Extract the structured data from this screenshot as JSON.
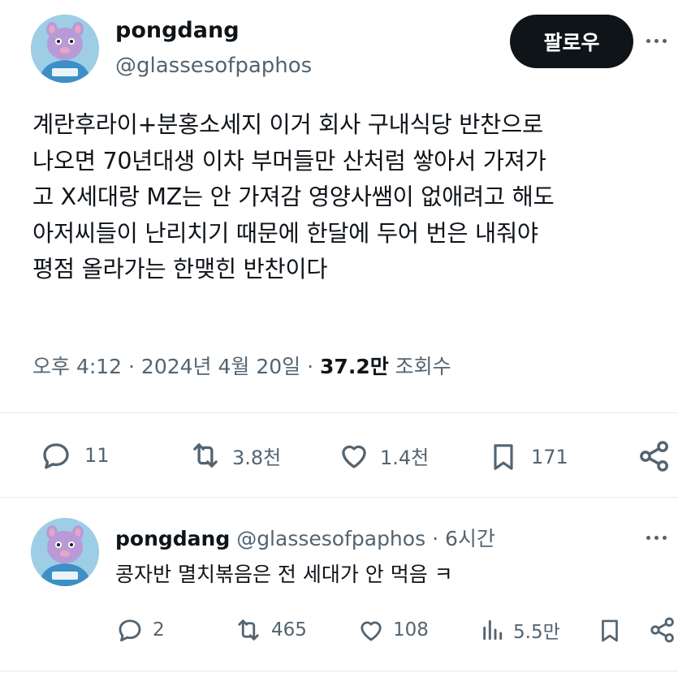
{
  "tweet": {
    "author": {
      "display_name": "pongdang",
      "handle": "@glassesofpaphos",
      "avatar_icon": "cartoon-avatar-icon"
    },
    "follow_label": "팔로우",
    "more_icon": "more-dots-icon",
    "text_lines": [
      "계란후라이+분홍소세지 이거 회사 구내식당 반찬으로",
      "나오면 70년대생 이차 부머들만 산처럼 쌓아서 가져가",
      "고 X세대랑 MZ는 안 가져감 영양사쌤이 없애려고 해도",
      "아저씨들이 난리치기 때문에 한달에 두어 번은 내줘야",
      "평점 올라가는 한맺힌 반찬이다"
    ],
    "timestamp": "오후 4:12 · 2024년 4월 20일",
    "views_count": "37.2만",
    "views_label": "조회수",
    "actions": {
      "replies": "11",
      "retweets": "3.8천",
      "likes": "1.4천",
      "bookmarks": "171"
    }
  },
  "reply": {
    "author": {
      "display_name": "pongdang",
      "handle": "@glassesofpaphos",
      "time": "6시간"
    },
    "text": "콩자반 멸치볶음은 전 세대가 안 먹음 ㅋ",
    "actions": {
      "replies": "2",
      "retweets": "465",
      "likes": "108",
      "views": "5.5만"
    }
  },
  "colors": {
    "text": "#0f1419",
    "secondary": "#536471",
    "button": "#0f1419",
    "divider": "#e6e9eb",
    "avatar_bg": "#9ecde6"
  }
}
